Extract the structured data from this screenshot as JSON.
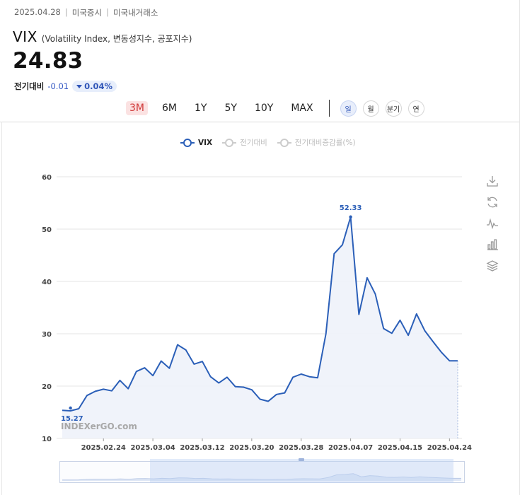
{
  "header": {
    "date": "2025.04.28",
    "crumbs": [
      "미국증시",
      "미국내거래소"
    ],
    "title": "VIX",
    "subtitle": "(Volatility Index, 변동성지수, 공포지수)",
    "price": "24.83",
    "change_label": "전기대비",
    "change_value": "-0.01",
    "change_pct": "0.04%"
  },
  "periods": [
    {
      "label": "3M",
      "active": true
    },
    {
      "label": "6M",
      "active": false
    },
    {
      "label": "1Y",
      "active": false
    },
    {
      "label": "5Y",
      "active": false
    },
    {
      "label": "10Y",
      "active": false
    },
    {
      "label": "MAX",
      "active": false
    }
  ],
  "units": [
    {
      "label": "일",
      "active": true
    },
    {
      "label": "월",
      "active": false
    },
    {
      "label": "분기",
      "active": false
    },
    {
      "label": "연",
      "active": false
    }
  ],
  "legend": [
    {
      "label": "VIX",
      "active": true
    },
    {
      "label": "전기대비",
      "active": false
    },
    {
      "label": "전기대비증감률(%)",
      "active": false
    }
  ],
  "tools": [
    "download-icon",
    "refresh-icon",
    "line-chart-icon",
    "bar-chart-icon",
    "layers-icon"
  ],
  "colors": {
    "series": "#2b5fb8",
    "area": "#eef2f9",
    "grid": "#e6e6e6",
    "active_period_bg": "#fbe2e2",
    "active_period_text": "#d03838"
  },
  "chart_data": {
    "type": "area",
    "title": "",
    "xlabel": "",
    "ylabel": "",
    "ylim": [
      10,
      60
    ],
    "yticks": [
      10,
      20,
      30,
      40,
      50,
      60
    ],
    "grid": true,
    "legend_position": "top-center",
    "watermark": "INDEXerGO.com",
    "xtick_labels": [
      "2025.02.24",
      "2025.03.04",
      "2025.03.12",
      "2025.03.20",
      "2025.03.28",
      "2025.04.07",
      "2025.04.15",
      "2025.04.24"
    ],
    "min_label": "15.27",
    "max_label": "52.33",
    "series": [
      {
        "name": "VIX",
        "x": [
          "2025.02.14",
          "2025.02.18",
          "2025.02.19",
          "2025.02.20",
          "2025.02.21",
          "2025.02.24",
          "2025.02.25",
          "2025.02.26",
          "2025.02.27",
          "2025.02.28",
          "2025.03.03",
          "2025.03.04",
          "2025.03.05",
          "2025.03.06",
          "2025.03.07",
          "2025.03.10",
          "2025.03.11",
          "2025.03.12",
          "2025.03.13",
          "2025.03.14",
          "2025.03.17",
          "2025.03.18",
          "2025.03.19",
          "2025.03.20",
          "2025.03.21",
          "2025.03.24",
          "2025.03.25",
          "2025.03.26",
          "2025.03.27",
          "2025.03.28",
          "2025.03.31",
          "2025.04.01",
          "2025.04.02",
          "2025.04.03",
          "2025.04.04",
          "2025.04.07",
          "2025.04.08",
          "2025.04.09",
          "2025.04.10",
          "2025.04.11",
          "2025.04.14",
          "2025.04.15",
          "2025.04.16",
          "2025.04.17",
          "2025.04.21",
          "2025.04.22",
          "2025.04.23",
          "2025.04.24",
          "2025.04.25"
        ],
        "values": [
          15.37,
          15.27,
          15.67,
          18.2,
          19.0,
          19.4,
          19.1,
          21.1,
          19.5,
          22.8,
          23.5,
          22.0,
          24.8,
          23.4,
          27.9,
          26.9,
          24.2,
          24.7,
          21.8,
          20.6,
          21.7,
          19.9,
          19.8,
          19.3,
          17.5,
          17.1,
          18.4,
          18.7,
          21.7,
          22.3,
          21.8,
          21.6,
          30.0,
          45.3,
          47.0,
          52.33,
          33.7,
          40.7,
          37.6,
          31.0,
          30.1,
          32.6,
          29.7,
          33.8,
          30.6,
          28.5,
          26.5,
          24.84,
          24.83
        ]
      }
    ]
  }
}
